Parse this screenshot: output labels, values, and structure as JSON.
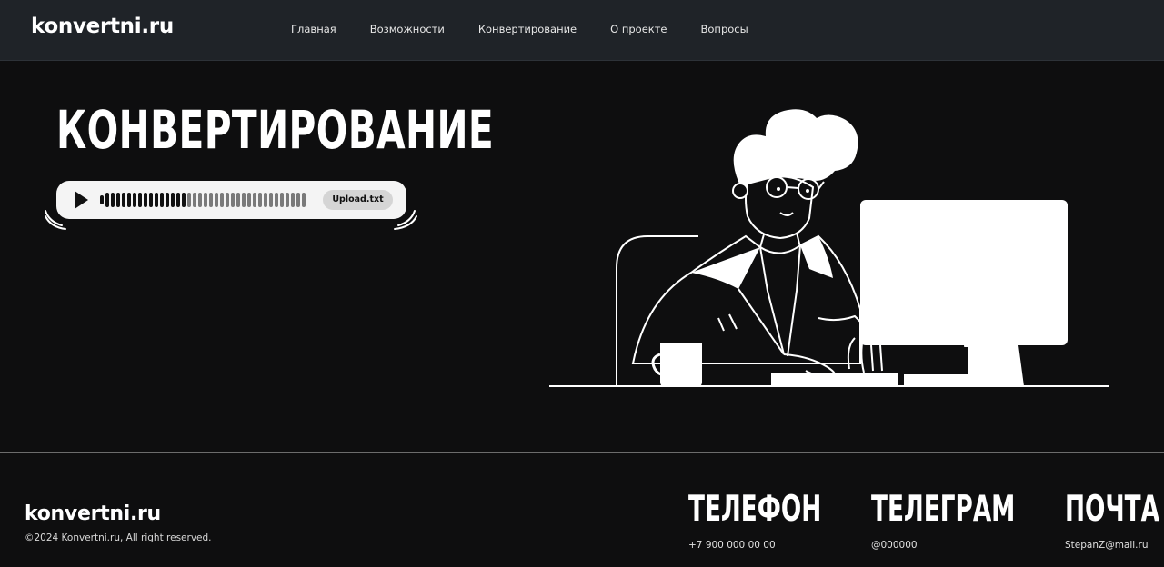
{
  "header": {
    "logo": "konvertni.ru",
    "nav": [
      "Главная",
      "Возможности",
      "Конвертирование",
      "О проекте",
      "Вопросы"
    ]
  },
  "hero": {
    "title": "КОНВЕРТИРОВАНИЕ",
    "player": {
      "upload_label": "Upload.txt",
      "progress": 0.42
    }
  },
  "footer": {
    "logo": "konvertni.ru",
    "copyright": "©2024 Konvertni.ru, All right reserved.",
    "phone": {
      "title": "ТЕЛЕФОН",
      "value": "+7 900 000 00 00"
    },
    "telegram": {
      "title": "ТЕЛЕГРАМ",
      "value": "@000000"
    },
    "email": {
      "title": "ПОЧТА",
      "value": "StepanZ@mail.ru"
    }
  },
  "colors": {
    "header_bg": "#1f2328",
    "page_bg": "#0e0e0f",
    "player_bg": "#f4f4f4",
    "accent": "#ffffff"
  },
  "icons": [
    "play-icon",
    "sound-wave-icon",
    "person-at-computer-illustration"
  ]
}
